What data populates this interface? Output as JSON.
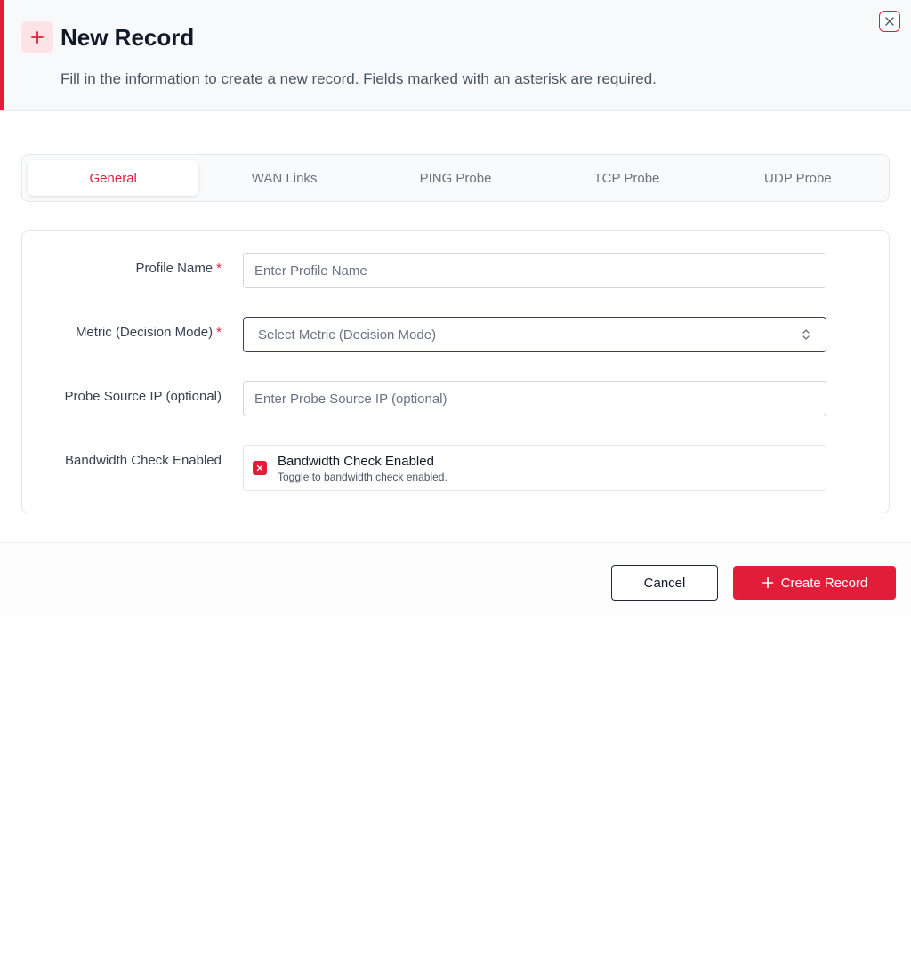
{
  "dialog": {
    "title": "New Record",
    "subtitle": "Fill in the information to create a new record. Fields marked with an asterisk are required.",
    "header_icon": "plus-icon",
    "close_icon": "close-icon"
  },
  "tabs": [
    {
      "label": "General",
      "active": true
    },
    {
      "label": "WAN Links",
      "active": false
    },
    {
      "label": "PING Probe",
      "active": false
    },
    {
      "label": "TCP Probe",
      "active": false
    },
    {
      "label": "UDP Probe",
      "active": false
    }
  ],
  "form": {
    "profile_name": {
      "label": "Profile Name",
      "required_mark": "*",
      "value": "",
      "placeholder": "Enter Profile Name"
    },
    "metric": {
      "label": "Metric (Decision Mode)",
      "required_mark": "*",
      "value": "Select Metric (Decision Mode)",
      "icon": "chevron-up-down-icon"
    },
    "probe_source_ip": {
      "label": "Probe Source IP (optional)",
      "value": "",
      "placeholder": "Enter Probe Source IP (optional)"
    },
    "bandwidth_check": {
      "label": "Bandwidth Check Enabled",
      "toggle_title": "Bandwidth Check Enabled",
      "toggle_description": "Toggle to bandwidth check enabled.",
      "checked": true
    }
  },
  "footer": {
    "cancel_label": "Cancel",
    "create_label": "Create Record"
  },
  "colors": {
    "accent": "#e11d3a",
    "accent_light": "#fde2e6"
  }
}
